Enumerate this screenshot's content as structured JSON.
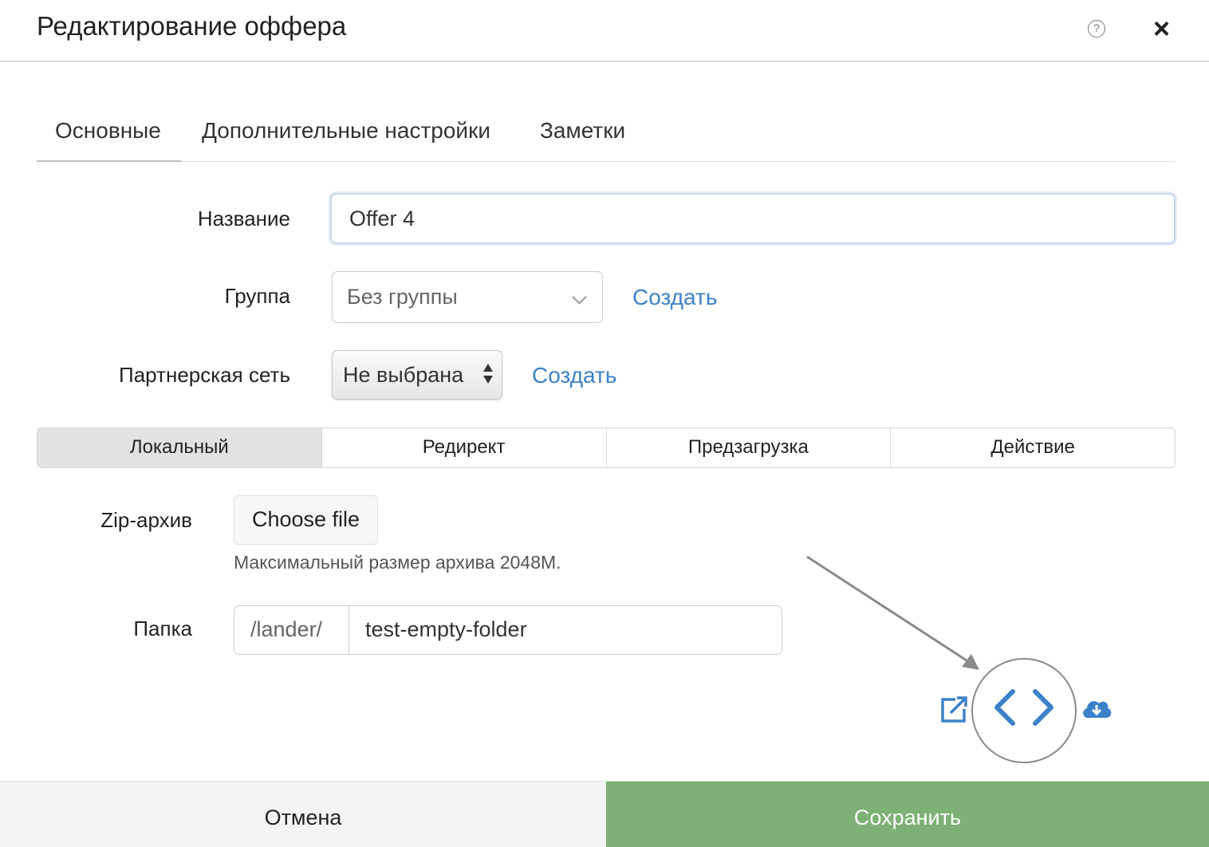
{
  "dialog": {
    "title": "Редактирование оффера",
    "help_icon": "question-circle-icon",
    "close_icon": "close-icon"
  },
  "tabs": [
    {
      "label": "Основные",
      "active": true
    },
    {
      "label": "Дополнительные настройки",
      "active": false
    },
    {
      "label": "Заметки",
      "active": false
    }
  ],
  "form": {
    "name": {
      "label": "Название",
      "value": "Offer 4"
    },
    "group": {
      "label": "Группа",
      "value": "Без группы",
      "create_link": "Создать"
    },
    "network": {
      "label": "Партнерская сеть",
      "value": "Не выбрана",
      "create_link": "Создать"
    }
  },
  "type_segments": [
    {
      "label": "Локальный",
      "active": true
    },
    {
      "label": "Редирект",
      "active": false
    },
    {
      "label": "Предзагрузка",
      "active": false
    },
    {
      "label": "Действие",
      "active": false
    }
  ],
  "zip": {
    "label": "Zip-архив",
    "button": "Choose file",
    "hint": "Максимальный размер архива 2048M."
  },
  "folder": {
    "label": "Папка",
    "prefix": "/lander/",
    "value": "test-empty-folder"
  },
  "actions": {
    "icons": [
      "external-link-icon",
      "code-icon",
      "cloud-download-icon"
    ],
    "accent_color": "#3c82c9"
  },
  "footer": {
    "cancel": "Отмена",
    "save": "Сохранить",
    "save_color": "#7db175"
  }
}
